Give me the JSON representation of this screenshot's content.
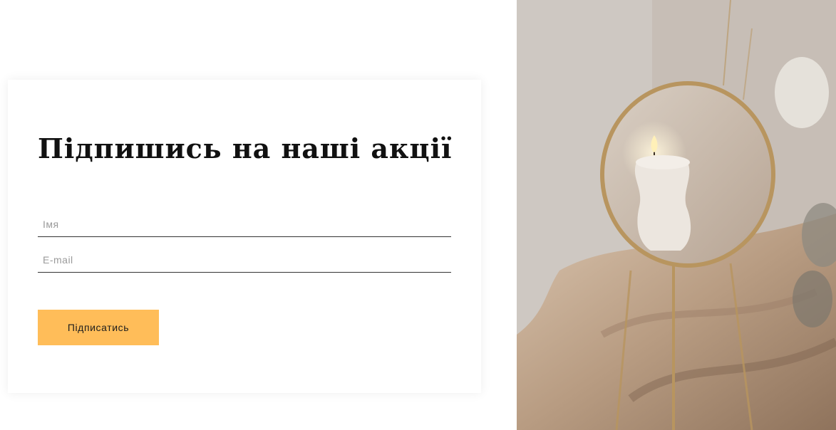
{
  "subscribe": {
    "title": "Підпишись на наші акції",
    "name_placeholder": "Імя",
    "email_placeholder": "E-mail",
    "submit_label": "Підписатись"
  },
  "colors": {
    "accent": "#ffbd59",
    "text": "#111111",
    "placeholder": "#9a9a9a"
  },
  "image": {
    "icon": "candle-photo"
  }
}
